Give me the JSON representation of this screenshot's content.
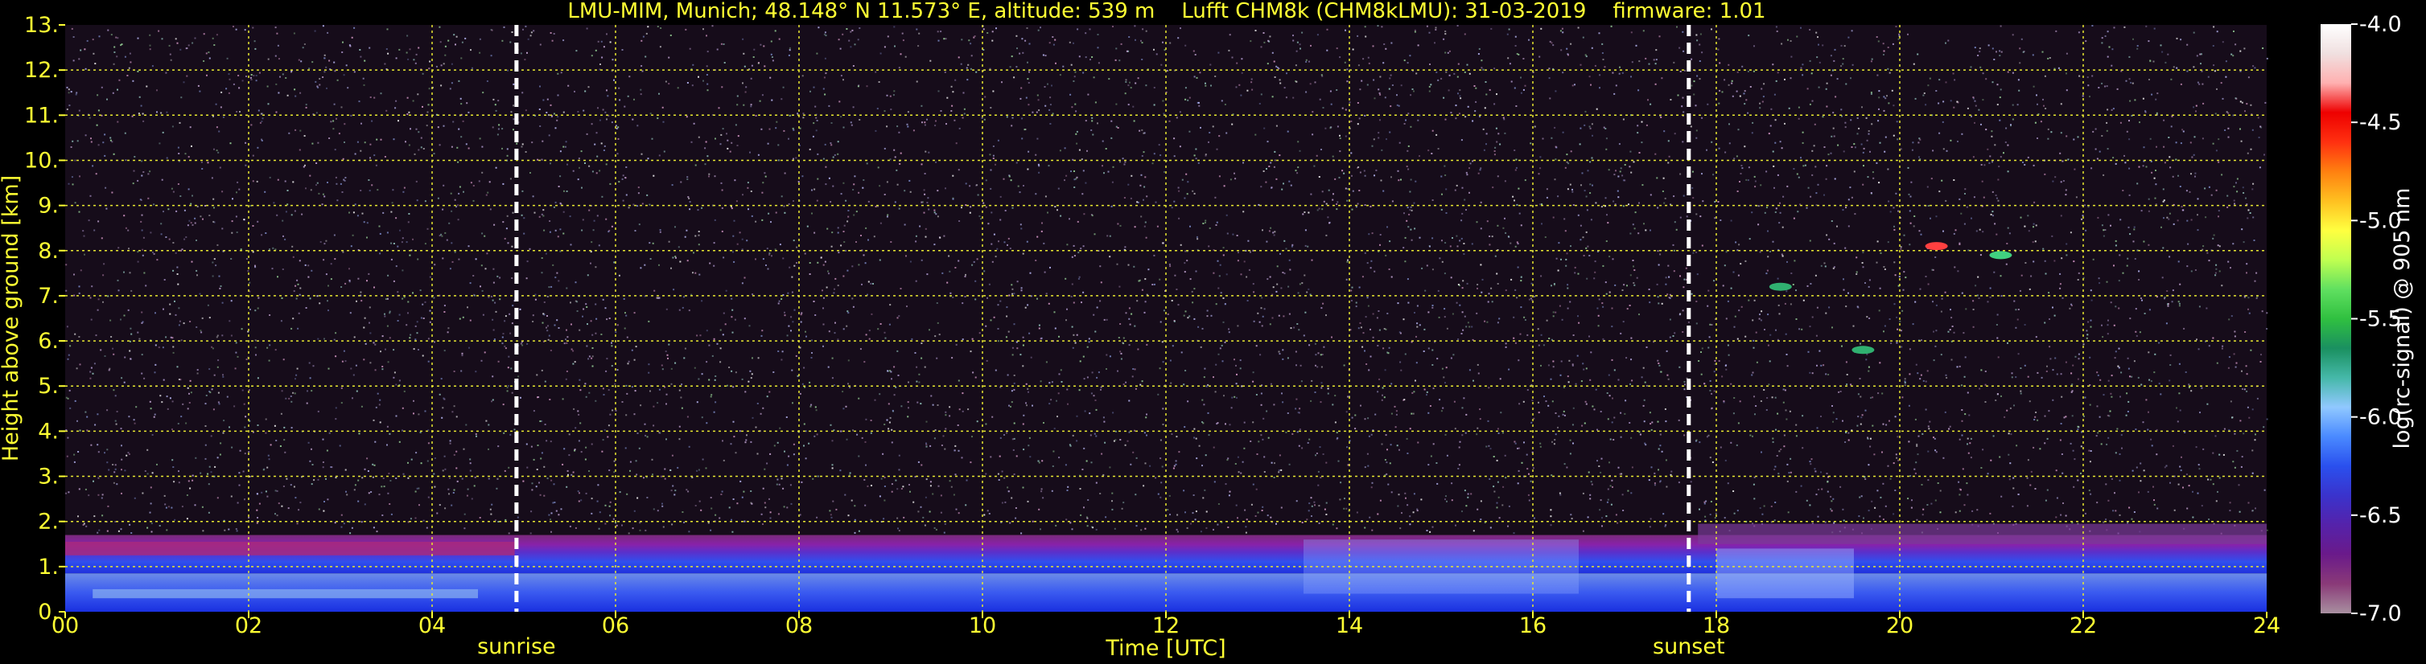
{
  "chart_data": {
    "type": "heatmap",
    "title": "LMU-MIM, Munich; 48.148° N 11.573° E, altitude: 539 m    Lufft CHM8k (CHM8kLMU): 31-03-2019    firmware: 1.01",
    "xlabel": "Time [UTC]",
    "ylabel": "Height above ground [km]",
    "xlim": [
      0,
      24
    ],
    "ylim": [
      0,
      13
    ],
    "x_ticks": [
      "00",
      "02",
      "04",
      "06",
      "08",
      "10",
      "12",
      "14",
      "16",
      "18",
      "20",
      "22",
      "24"
    ],
    "y_ticks": [
      "0.",
      "1.",
      "2.",
      "3.",
      "4.",
      "5.",
      "6.",
      "7.",
      "8.",
      "9.",
      "10.",
      "11.",
      "12.",
      "13."
    ],
    "grid": true,
    "markers": [
      {
        "label": "sunrise",
        "x": 4.92
      },
      {
        "label": "sunset",
        "x": 17.7
      }
    ],
    "colorbar": {
      "label": "log(rc-signal) @ 905 nm",
      "range": [
        -7.0,
        -4.0
      ],
      "ticks": [
        "-4.0",
        "-4.5",
        "-5.0",
        "-5.5",
        "-6.0",
        "-6.5",
        "-7.0"
      ],
      "colors": [
        "#a890a0",
        "#8a3a78",
        "#6a1a8a",
        "#5522aa",
        "#3a33cc",
        "#2a50ee",
        "#4a8aff",
        "#90c8ff",
        "#45b8a8",
        "#1a9060",
        "#30c040",
        "#60e060",
        "#c0ff50",
        "#ffff40",
        "#ffc020",
        "#ff8010",
        "#ff3010",
        "#ee0000",
        "#ffb0b0",
        "#f0e0e0",
        "#ffffff"
      ]
    },
    "layers": [
      {
        "x_range": [
          0,
          24
        ],
        "height_km": [
          0,
          0.85
        ],
        "value": -6.1
      },
      {
        "x_range": [
          0,
          24
        ],
        "height_km": [
          0.85,
          1.7
        ],
        "value": -6.5
      },
      {
        "x_range": [
          0,
          24
        ],
        "height_km": [
          1.7,
          13
        ],
        "value": -6.8
      }
    ],
    "clouds": [
      {
        "x": 20.4,
        "height_km": 8.1,
        "value": -5.0
      },
      {
        "x": 21.1,
        "height_km": 7.9,
        "value": -5.7
      },
      {
        "x": 18.7,
        "height_km": 7.2,
        "value": -5.9
      },
      {
        "x": 19.6,
        "height_km": 5.8,
        "value": -5.9
      }
    ]
  }
}
